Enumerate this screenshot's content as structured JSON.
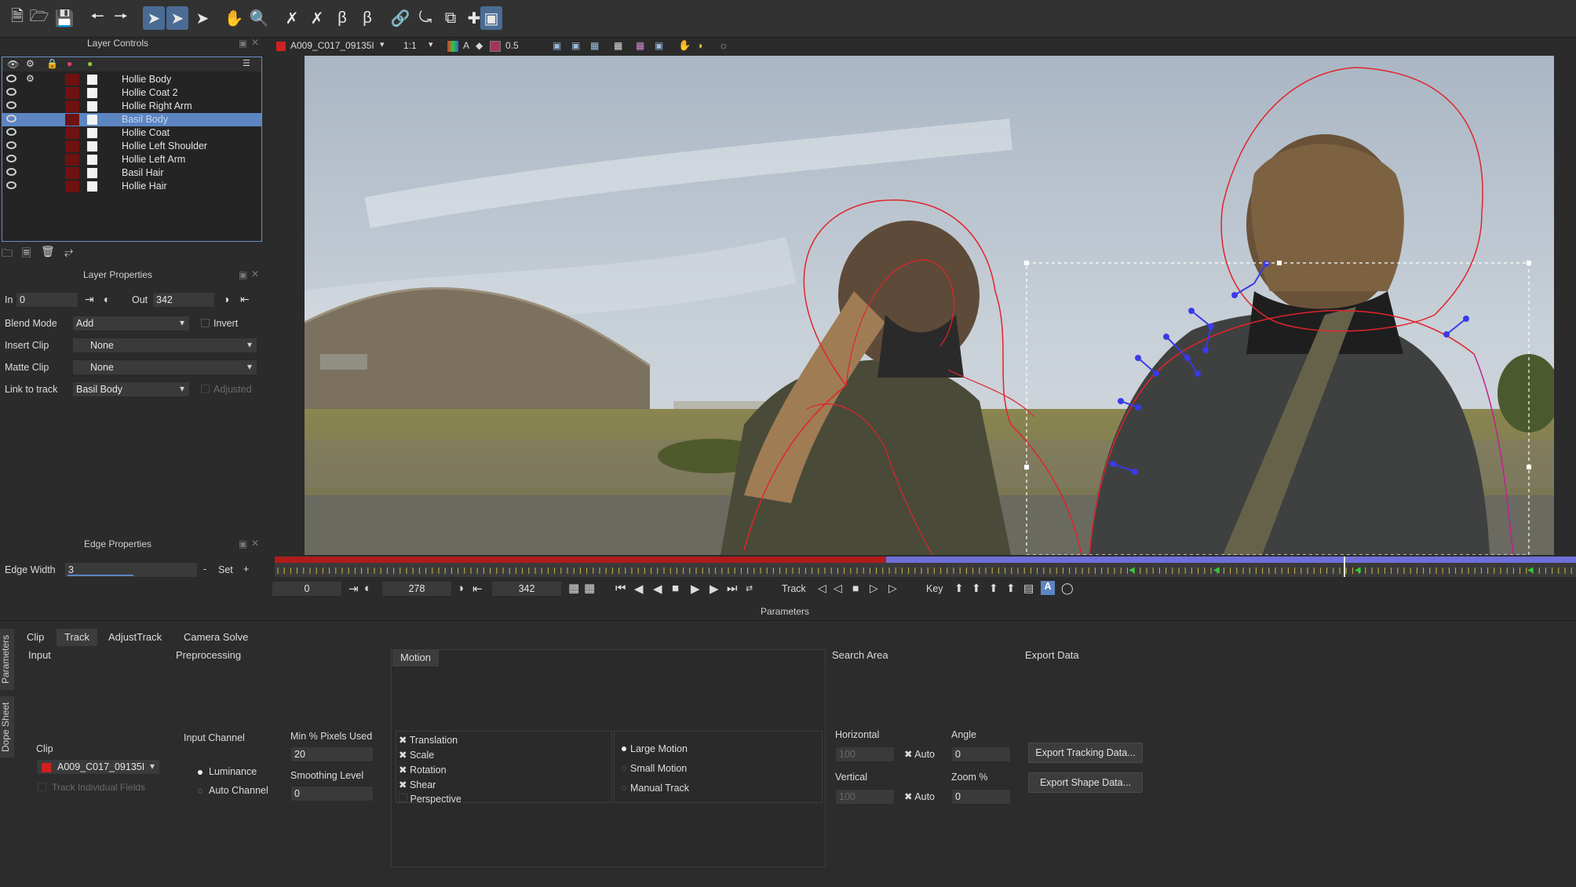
{
  "toolbar": {
    "clip_name": "A009_C017_09135I",
    "zoom": "1:1",
    "opacity": "0.5"
  },
  "layer_controls": {
    "title": "Layer Controls",
    "layers": [
      {
        "name": "Hollie Body"
      },
      {
        "name": "Hollie Coat 2"
      },
      {
        "name": "Hollie Right Arm"
      },
      {
        "name": "Basil Body",
        "selected": true
      },
      {
        "name": "Hollie Coat"
      },
      {
        "name": "Hollie Left Shoulder"
      },
      {
        "name": "Hollie Left Arm"
      },
      {
        "name": "Basil Hair"
      },
      {
        "name": "Hollie Hair"
      }
    ]
  },
  "layer_properties": {
    "title": "Layer Properties",
    "in_label": "In",
    "in_value": "0",
    "out_label": "Out",
    "out_value": "342",
    "blend_mode_label": "Blend Mode",
    "blend_mode_value": "Add",
    "invert_label": "Invert",
    "insert_clip_label": "Insert Clip",
    "insert_clip_value": "None",
    "matte_clip_label": "Matte Clip",
    "matte_clip_value": "None",
    "link_to_track_label": "Link to track",
    "link_to_track_value": "Basil Body",
    "adjusted_label": "Adjusted"
  },
  "edge_properties": {
    "title": "Edge Properties",
    "edge_width_label": "Edge Width",
    "edge_width_value": "3",
    "set_label": "Set"
  },
  "transport": {
    "start_frame": "0",
    "current_frame": "278",
    "end_frame": "342",
    "track_label": "Track",
    "key_label": "Key",
    "track_fraction": 0.82
  },
  "parameters": {
    "title": "Parameters",
    "side_tabs": [
      "Parameters",
      "Dope Sheet"
    ],
    "tabs": [
      "Clip",
      "Track",
      "AdjustTrack",
      "Camera Solve"
    ],
    "active_tab": "Track",
    "input_title": "Input",
    "clip_label": "Clip",
    "clip_value": "A009_C017_09135I",
    "track_individual_fields": "Track Individual Fields",
    "preprocessing_title": "Preprocessing",
    "input_channel_label": "Input Channel",
    "luminance_label": "Luminance",
    "auto_channel_label": "Auto Channel",
    "min_pixels_label": "Min % Pixels Used",
    "min_pixels_value": "20",
    "smoothing_label": "Smoothing Level",
    "smoothing_value": "0",
    "motion_title": "Motion",
    "motion_checks": [
      "Translation",
      "Scale",
      "Rotation",
      "Shear",
      "Perspective"
    ],
    "motion_types": [
      "Large Motion",
      "Small Motion",
      "Manual Track"
    ],
    "search_area_title": "Search Area",
    "horizontal_label": "Horizontal",
    "horizontal_value": "100",
    "vertical_label": "Vertical",
    "vertical_value": "100",
    "auto_label": "Auto",
    "angle_label": "Angle",
    "angle_value": "0",
    "zoom_label": "Zoom %",
    "zoom_value": "0",
    "export_title": "Export Data",
    "export_tracking": "Export Tracking Data...",
    "export_shape": "Export Shape Data..."
  },
  "colors": {
    "accent": "#5c85c2",
    "spline": "#e0242c",
    "tangent": "#3a3ae8",
    "timeline_red": "#b01c1c",
    "timeline_blue": "#6f6fd8"
  }
}
